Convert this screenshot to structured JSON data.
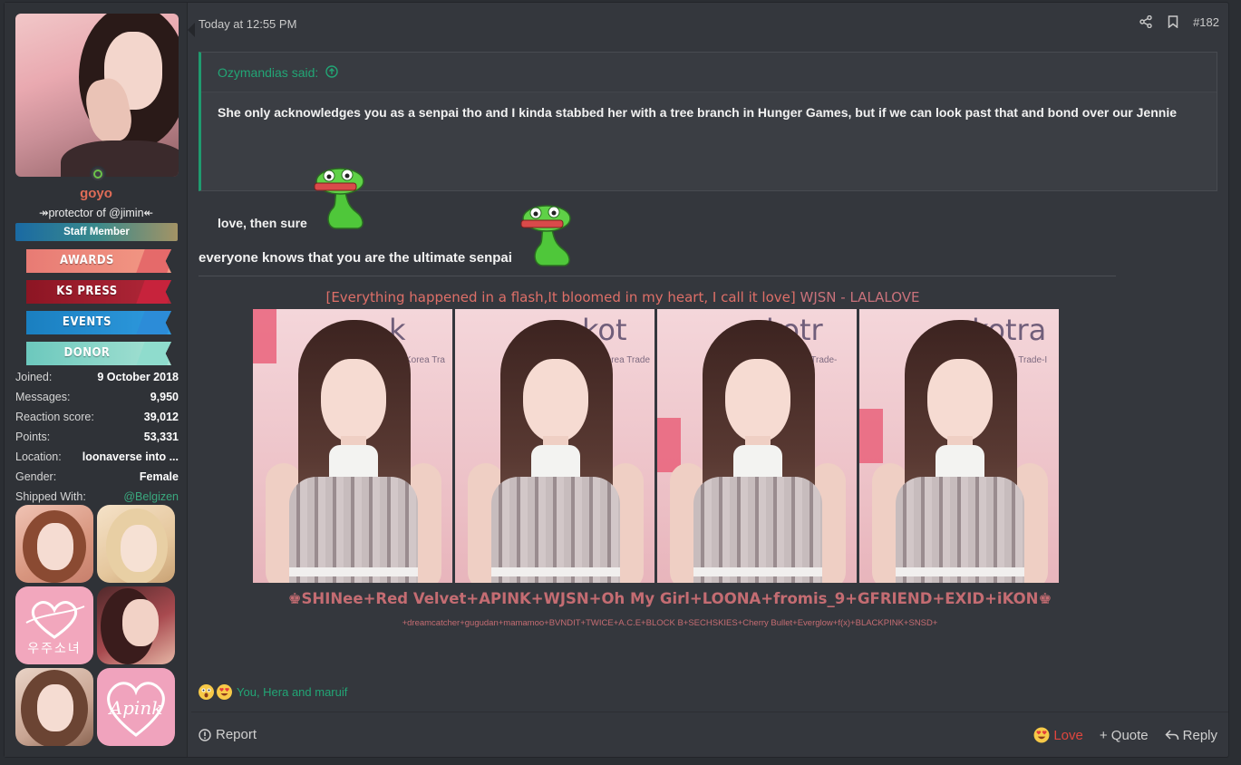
{
  "user": {
    "username": "goyo",
    "title": "↠protector of @jimin↞",
    "staff_banner": "Staff Member",
    "ribbons": [
      "AWARDS",
      "KS PRESS",
      "EVENTS",
      "DONOR"
    ],
    "stats": [
      {
        "label": "Joined:",
        "value": "9 October 2018"
      },
      {
        "label": "Messages:",
        "value": "9,950"
      },
      {
        "label": "Reaction score:",
        "value": "39,012"
      },
      {
        "label": "Points:",
        "value": "53,331"
      },
      {
        "label": "Location:",
        "value": "loonaverse into ..."
      },
      {
        "label": "Gender:",
        "value": "Female"
      },
      {
        "label": "Shipped With:",
        "value": "@Belgizen"
      }
    ],
    "ship_image_texts": [
      "우주소녀",
      "Apink"
    ]
  },
  "post": {
    "time": "Today at 12:55 PM",
    "number": "#182",
    "quote": {
      "author": "Ozymandias said:",
      "line1": "She only acknowledges you as a senpai tho and I kinda stabbed her with a tree branch in Hunger Games, but if we can look past that and bond over our Jennie",
      "line2": "love, then sure"
    },
    "message": "everyone knows that you are the ultimate senpai",
    "signature": {
      "title": "[Everything happened in a flash,It bloomed in my heart, I call it love]",
      "title_suffix": "WJSN - LALALOVE",
      "photo_texts": [
        "Korea Tra",
        "Korea Trade",
        "Korea Trade-",
        "kotra",
        "Korea Trade-I"
      ],
      "groups": "♚SHINee+Red Velvet+APINK+WJSN+Oh My Girl+LOONA+fromis_9+GFRIEND+EXID+iKON♚",
      "subgroups": "+dreamcatcher+gugudan+mamamoo+BVNDIT+TWICE+A.C.E+BLOCK B+SECHSKIES+Cherry Bullet+Everglow+f(x)+BLACKPINK+SNSD+"
    },
    "reactions": {
      "names": "You, Hera and maruif",
      "emojis": [
        "astonished-emoji",
        "heart-eyes-emoji"
      ]
    },
    "footer": {
      "report": "Report",
      "love": "Love",
      "quote": "+ Quote",
      "reply": "Reply"
    }
  },
  "colors": {
    "accent_green": "#22a575",
    "username": "#e06c57",
    "signature": "#c46c72",
    "love": "#e0463e"
  }
}
